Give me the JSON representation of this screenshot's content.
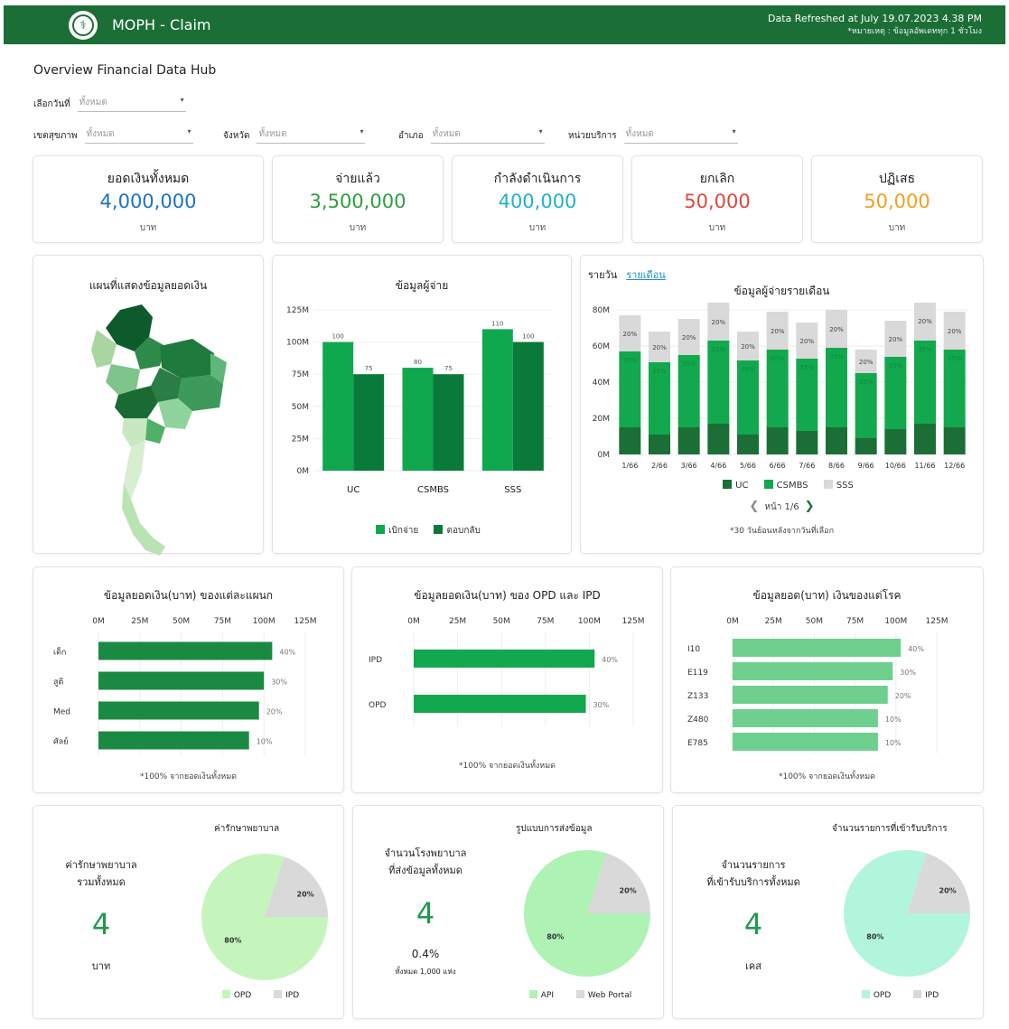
{
  "header": {
    "title": "MOPH - Claim",
    "logo_glyph": "⚕",
    "refreshed": "Data Refreshed at July 19.07.2023 4.38 PM",
    "note": "*หมายเหตุ : ข้อมูลอัพเดททุก 1 ชั่วโมง"
  },
  "page_title": "Overview Financial Data Hub",
  "filters": {
    "date": {
      "label": "เลือกวันที่",
      "value": "ทั้งหมด"
    },
    "region": {
      "label": "เขตสุขภาพ",
      "value": "ทั้งหมด"
    },
    "province": {
      "label": "จังหวัด",
      "value": "ทั้งหมด"
    },
    "district": {
      "label": "อำเภอ",
      "value": "ทั้งหมด"
    },
    "unit": {
      "label": "หน่วยบริการ",
      "value": "ทั้งหมด"
    },
    "arrow": "▾"
  },
  "kpis": [
    {
      "label": "ยอดเงินทั้งหมด",
      "value": "4,000,000",
      "unit": "บาท",
      "color": "#1a73c8"
    },
    {
      "label": "จ่ายแล้ว",
      "value": "3,500,000",
      "unit": "บาท",
      "color": "#2e9e3e"
    },
    {
      "label": "กำลังดำเนินการ",
      "value": "400,000",
      "unit": "บาท",
      "color": "#1fb3c8"
    },
    {
      "label": "ยกเลิก",
      "value": "50,000",
      "unit": "บาท",
      "color": "#e0463c"
    },
    {
      "label": "ปฏิเสธ",
      "value": "50,000",
      "unit": "บาท",
      "color": "#f0a21c"
    }
  ],
  "map": {
    "title": "แผนที่แสดงข้อมูลยอดเงิน"
  },
  "payer": {
    "title": "ข้อมูลผู้จ่าย",
    "chart_data": {
      "type": "bar",
      "categories": [
        "UC",
        "CSMBS",
        "SSS"
      ],
      "series": [
        {
          "name": "เบิกจ่าย",
          "values": [
            100,
            80,
            110
          ],
          "color": "#0fa84f"
        },
        {
          "name": "ตอบกลับ",
          "values": [
            75,
            75,
            100
          ],
          "color": "#0a7a3a"
        }
      ],
      "yticks": [
        "0M",
        "25M",
        "50M",
        "75M",
        "100M",
        "125M"
      ],
      "ylim": [
        0,
        125
      ]
    }
  },
  "monthly": {
    "tab_day": "รายวัน",
    "tab_month": "รายเดือน",
    "title": "ข้อมูลผู้จ่ายรายเดือน",
    "chart_data": {
      "type": "bar",
      "stacked": true,
      "categories": [
        "1/66",
        "2/66",
        "3/66",
        "4/66",
        "5/66",
        "6/66",
        "7/66",
        "8/66",
        "9/66",
        "10/66",
        "11/66",
        "12/66"
      ],
      "series": [
        {
          "name": "UC",
          "values": [
            15,
            11,
            15,
            17,
            11,
            15,
            13,
            15,
            9,
            14,
            17,
            15
          ],
          "color": "#1b6e35"
        },
        {
          "name": "CSMBS",
          "values": [
            42,
            40,
            40,
            46,
            41,
            43,
            40,
            44,
            36,
            40,
            46,
            43
          ],
          "color": "#12a84e"
        },
        {
          "name": "SSS",
          "values": [
            20,
            17,
            20,
            21,
            16,
            21,
            20,
            21,
            13,
            20,
            22,
            21
          ],
          "color": "#d9d9d9"
        }
      ],
      "top_labels": [
        "20%",
        "20%",
        "20%",
        "20%",
        "20%",
        "20%",
        "20%",
        "20%",
        "20%",
        "20%",
        "20%",
        "20%"
      ],
      "mid_labels": [
        "35%",
        "35%",
        "35%",
        "35%",
        "35%",
        "35%",
        "35%",
        "35%",
        "35%",
        "35%",
        "35%",
        "35%"
      ],
      "yticks": [
        "0M",
        "20M",
        "40M",
        "60M",
        "80M"
      ],
      "ylim": [
        0,
        80
      ]
    },
    "pager": {
      "prev": "❮",
      "text": "หน้า 1/6",
      "next": "❯"
    },
    "footnote": "*30 วันย้อนหลังจากวันที่เลือก"
  },
  "dept": {
    "title": "ข้อมูลยอดเงิน(บาท) ของแต่ละแผนก",
    "chart_data": {
      "type": "bar",
      "orientation": "horizontal",
      "categories": [
        "เด็ก",
        "สูติ",
        "Med",
        "ศัลย์"
      ],
      "values": [
        105,
        100,
        97,
        91
      ],
      "labels": [
        "40%",
        "30%",
        "20%",
        "10%"
      ],
      "color": "#1a8a43",
      "xticks": [
        "0M",
        "25M",
        "50M",
        "75M",
        "100M",
        "125M"
      ],
      "xlim": [
        0,
        125
      ]
    },
    "footnote": "*100% จากยอดเงินทั้งหมด"
  },
  "opd": {
    "title": "ข้อมูลยอดเงิน(บาท) ของ OPD และ IPD",
    "chart_data": {
      "type": "bar",
      "orientation": "horizontal",
      "categories": [
        "IPD",
        "OPD"
      ],
      "values": [
        103,
        98
      ],
      "labels": [
        "40%",
        "30%"
      ],
      "color": "#12a84e",
      "xticks": [
        "0M",
        "25M",
        "50M",
        "75M",
        "100M",
        "125M"
      ],
      "xlim": [
        0,
        125
      ]
    },
    "footnote": "*100% จากยอดเงินทั้งหมด"
  },
  "disease": {
    "title": "ข้อมูลยอด(บาท) เงินของแต่โรค",
    "chart_data": {
      "type": "bar",
      "orientation": "horizontal",
      "categories": [
        "I10",
        "E119",
        "Z133",
        "Z480",
        "E785"
      ],
      "values": [
        103,
        98,
        95,
        89,
        89
      ],
      "labels": [
        "40%",
        "30%",
        "20%",
        "10%",
        "10%"
      ],
      "color": "#6fcf8f",
      "xticks": [
        "0M",
        "25M",
        "50M",
        "75M",
        "100M",
        "125M"
      ],
      "xlim": [
        0,
        125
      ]
    },
    "footnote": "*100% จากยอดเงินทั้งหมด"
  },
  "pies": [
    {
      "chart_title": "ค่ารักษาพยาบาล",
      "label_lines": [
        "ค่ารักษาพยาบาล",
        "รวมทั้งหมด"
      ],
      "value": "4",
      "unit": "บาท",
      "sub1": "",
      "sub2": "",
      "chart_data": {
        "type": "pie",
        "slices": [
          {
            "name": "OPD",
            "value": 80,
            "label": "80%",
            "color": "#c5f5bc"
          },
          {
            "name": "IPD",
            "value": 20,
            "label": "20%",
            "color": "#d9d9d9"
          }
        ]
      }
    },
    {
      "chart_title": "รูปแบบการส่งข้อมูล",
      "label_lines": [
        "จำนวนโรงพยาบาล",
        "ที่ส่งข้อมูลทั้งหมด"
      ],
      "value": "4",
      "unit": "",
      "sub1": "0.4%",
      "sub2": "ทั้งหมด 1,000 แห่ง",
      "chart_data": {
        "type": "pie",
        "slices": [
          {
            "name": "API",
            "value": 80,
            "label": "80%",
            "color": "#aef2b4"
          },
          {
            "name": "Web Portal",
            "value": 20,
            "label": "20%",
            "color": "#d9d9d9"
          }
        ]
      }
    },
    {
      "chart_title": "จำนวนรายการที่เข้ารับบริการ",
      "label_lines": [
        "จำนวนรายการ",
        "ที่เข้ารับบริการทั้งหมด"
      ],
      "value": "4",
      "unit": "เคส",
      "sub1": "",
      "sub2": "",
      "chart_data": {
        "type": "pie",
        "slices": [
          {
            "name": "OPD",
            "value": 80,
            "label": "80%",
            "color": "#b0f5dc"
          },
          {
            "name": "IPD",
            "value": 20,
            "label": "20%",
            "color": "#d9d9d9"
          }
        ]
      }
    }
  ]
}
